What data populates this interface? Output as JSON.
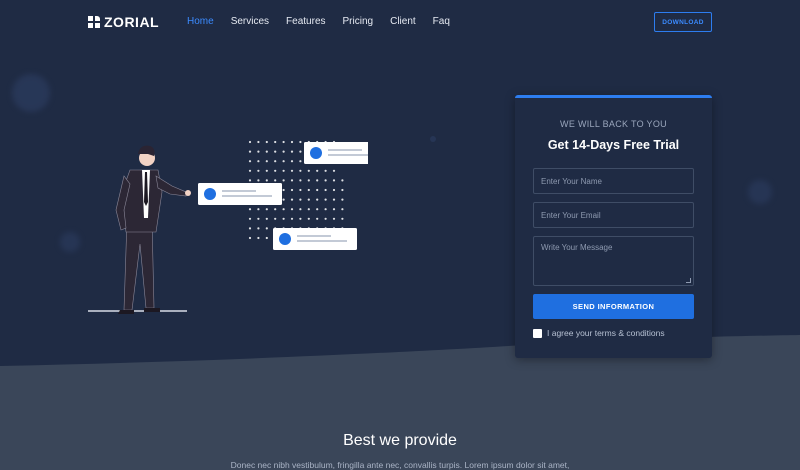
{
  "nav": {
    "logo": "ZORIAL",
    "links": [
      "Home",
      "Services",
      "Features",
      "Pricing",
      "Client",
      "Faq"
    ],
    "active_index": 0,
    "download": "DOWNLOAD"
  },
  "form": {
    "kicker": "WE WILL BACK TO YOU",
    "title": "Get 14-Days Free Trial",
    "name_placeholder": "Enter Your Name",
    "email_placeholder": "Enter Your Email",
    "message_placeholder": "Write Your Message",
    "submit": "SEND INFORMATION",
    "agree_label": "I agree your terms & conditions"
  },
  "section": {
    "title": "Best we provide",
    "subtitle": "Donec nec nibh vestibulum, fringilla ante nec, convallis turpis. Lorem ipsum dolor sit amet,"
  },
  "colors": {
    "hero_bg": "#1f2b44",
    "lower_bg": "#3a4659",
    "accent": "#1f6fe0"
  }
}
